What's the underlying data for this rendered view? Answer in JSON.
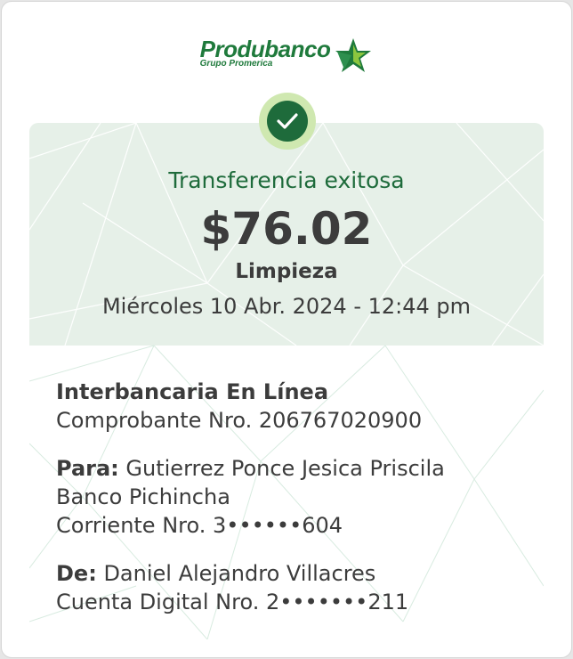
{
  "brand": {
    "name": "Produbanco",
    "group": "Grupo Promerica",
    "logo_icon": "star-icon",
    "colors": {
      "green": "#1f7a3c",
      "light_green": "#8cc63f"
    }
  },
  "status": {
    "icon": "check-circle-icon",
    "title": "Transferencia exitosa"
  },
  "transaction": {
    "amount": "$76.02",
    "category": "Limpieza",
    "datetime": "Miércoles 10 Abr. 2024 - 12:44 pm"
  },
  "details": {
    "type": "Interbancaria En Línea",
    "receipt": "Comprobante Nro. 206767020900",
    "to_label": "Para:",
    "to_name": "Gutierrez Ponce Jesica Priscila",
    "to_bank": "Banco Pichincha",
    "to_account": "Corriente Nro. 3••••••604",
    "from_label": "De:",
    "from_name": "Daniel Alejandro Villacres",
    "from_account": "Cuenta Digital Nro. 2•••••••211"
  }
}
